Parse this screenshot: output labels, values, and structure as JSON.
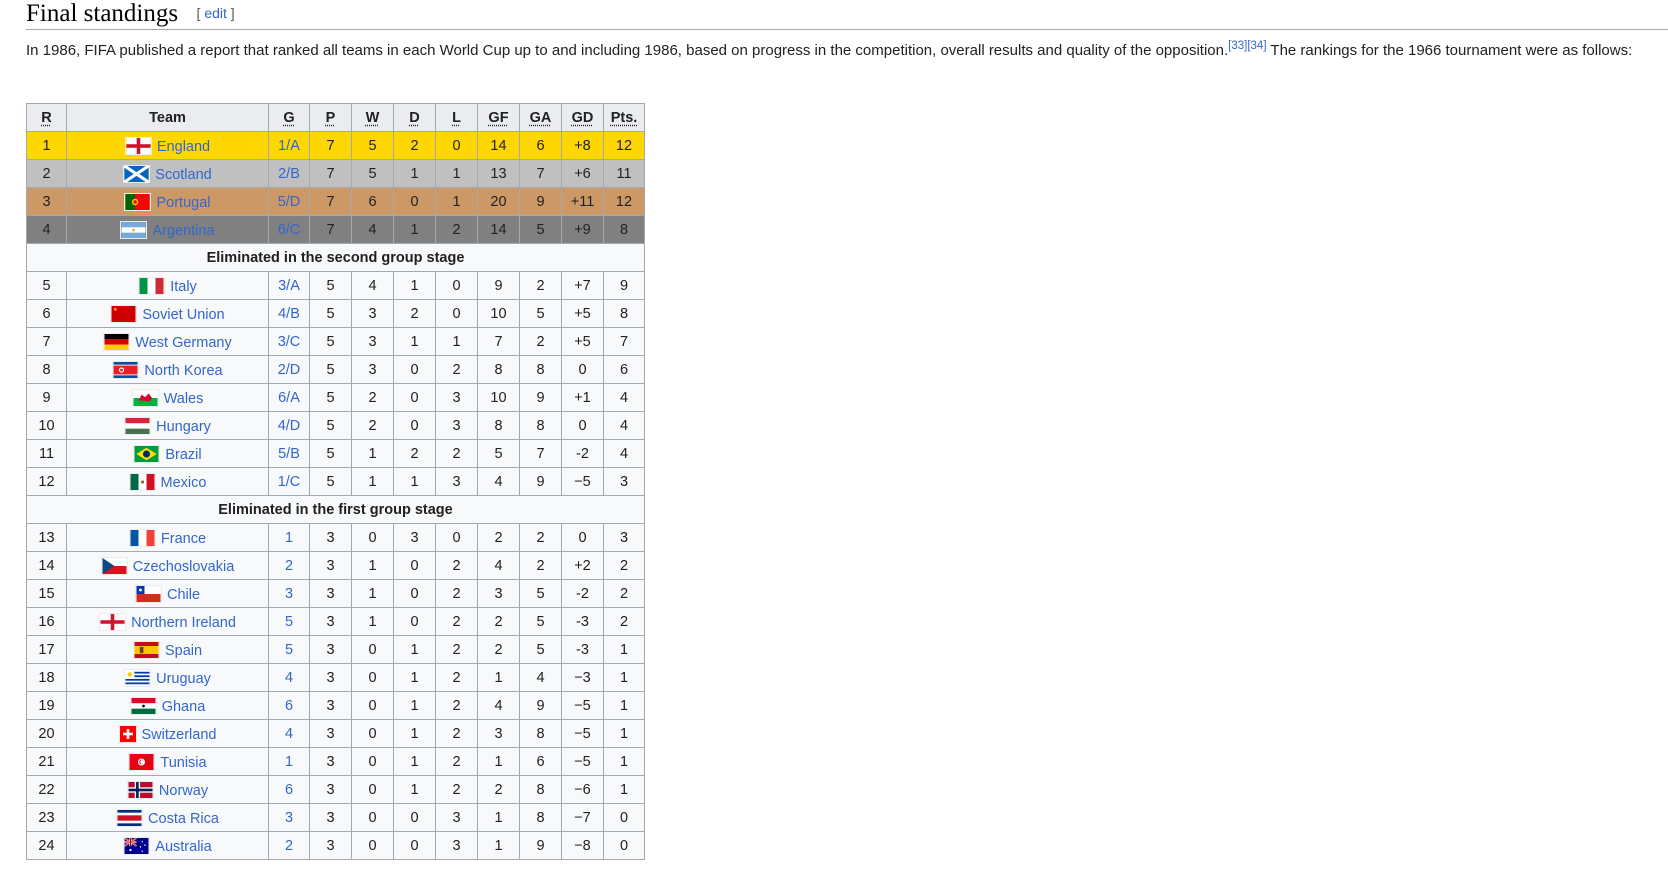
{
  "section": {
    "title": "Final standings",
    "edit_open": "[",
    "edit_label": "edit",
    "edit_close": "]"
  },
  "intro": {
    "text_before": "In 1986, FIFA published a report that ranked all teams in each World Cup up to and including 1986, based on progress in the competition, overall results and quality of the opposition.",
    "refs": [
      "[33]",
      "[34]"
    ],
    "text_after": " The rankings for the 1966 tournament were as follows:"
  },
  "table": {
    "headers": [
      "R",
      "Team",
      "G",
      "P",
      "W",
      "D",
      "L",
      "GF",
      "GA",
      "GD",
      "Pts."
    ],
    "sections": {
      "second_group": "Eliminated in the second group stage",
      "first_group": "Eliminated in the first group stage"
    },
    "rows": [
      {
        "r": "1",
        "team": "England",
        "flag": "england-flag",
        "g": "1/A",
        "p": "7",
        "w": "5",
        "d": "2",
        "l": "0",
        "gf": "14",
        "ga": "6",
        "gd": "+8",
        "pts": "12",
        "medal": "gold"
      },
      {
        "r": "2",
        "team": "Scotland",
        "flag": "scotland-flag",
        "g": "2/B",
        "p": "7",
        "w": "5",
        "d": "1",
        "l": "1",
        "gf": "13",
        "ga": "7",
        "gd": "+6",
        "pts": "11",
        "medal": "silver"
      },
      {
        "r": "3",
        "team": "Portugal",
        "flag": "portugal-flag",
        "g": "5/D",
        "p": "7",
        "w": "6",
        "d": "0",
        "l": "1",
        "gf": "20",
        "ga": "9",
        "gd": "+11",
        "pts": "12",
        "medal": "bronze"
      },
      {
        "r": "4",
        "team": "Argentina",
        "flag": "argentina-flag",
        "g": "6/C",
        "p": "7",
        "w": "4",
        "d": "1",
        "l": "2",
        "gf": "14",
        "ga": "5",
        "gd": "+9",
        "pts": "8",
        "medal": "fourth"
      },
      {
        "r": "5",
        "team": "Italy",
        "flag": "italy-flag",
        "g": "3/A",
        "p": "5",
        "w": "4",
        "d": "1",
        "l": "0",
        "gf": "9",
        "ga": "2",
        "gd": "+7",
        "pts": "9"
      },
      {
        "r": "6",
        "team": "Soviet Union",
        "flag": "soviet-union-flag",
        "g": "4/B",
        "p": "5",
        "w": "3",
        "d": "2",
        "l": "0",
        "gf": "10",
        "ga": "5",
        "gd": "+5",
        "pts": "8"
      },
      {
        "r": "7",
        "team": "West Germany",
        "flag": "west-germany-flag",
        "g": "3/C",
        "p": "5",
        "w": "3",
        "d": "1",
        "l": "1",
        "gf": "7",
        "ga": "2",
        "gd": "+5",
        "pts": "7"
      },
      {
        "r": "8",
        "team": "North Korea",
        "flag": "north-korea-flag",
        "g": "2/D",
        "p": "5",
        "w": "3",
        "d": "0",
        "l": "2",
        "gf": "8",
        "ga": "8",
        "gd": "0",
        "pts": "6"
      },
      {
        "r": "9",
        "team": "Wales",
        "flag": "wales-flag",
        "g": "6/A",
        "p": "5",
        "w": "2",
        "d": "0",
        "l": "3",
        "gf": "10",
        "ga": "9",
        "gd": "+1",
        "pts": "4"
      },
      {
        "r": "10",
        "team": "Hungary",
        "flag": "hungary-flag",
        "g": "4/D",
        "p": "5",
        "w": "2",
        "d": "0",
        "l": "3",
        "gf": "8",
        "ga": "8",
        "gd": "0",
        "pts": "4"
      },
      {
        "r": "11",
        "team": "Brazil",
        "flag": "brazil-flag",
        "g": "5/B",
        "p": "5",
        "w": "1",
        "d": "2",
        "l": "2",
        "gf": "5",
        "ga": "7",
        "gd": "-2",
        "pts": "4"
      },
      {
        "r": "12",
        "team": "Mexico",
        "flag": "mexico-flag",
        "g": "1/C",
        "p": "5",
        "w": "1",
        "d": "1",
        "l": "3",
        "gf": "4",
        "ga": "9",
        "gd": "−5",
        "pts": "3"
      },
      {
        "r": "13",
        "team": "France",
        "flag": "france-flag",
        "g": "1",
        "p": "3",
        "w": "0",
        "d": "3",
        "l": "0",
        "gf": "2",
        "ga": "2",
        "gd": "0",
        "pts": "3"
      },
      {
        "r": "14",
        "team": "Czechoslovakia",
        "flag": "czechoslovakia-flag",
        "g": "2",
        "p": "3",
        "w": "1",
        "d": "0",
        "l": "2",
        "gf": "4",
        "ga": "2",
        "gd": "+2",
        "pts": "2"
      },
      {
        "r": "15",
        "team": "Chile",
        "flag": "chile-flag",
        "g": "3",
        "p": "3",
        "w": "1",
        "d": "0",
        "l": "2",
        "gf": "3",
        "ga": "5",
        "gd": "-2",
        "pts": "2"
      },
      {
        "r": "16",
        "team": "Northern Ireland",
        "flag": "northern-ireland-flag",
        "g": "5",
        "p": "3",
        "w": "1",
        "d": "0",
        "l": "2",
        "gf": "2",
        "ga": "5",
        "gd": "-3",
        "pts": "2"
      },
      {
        "r": "17",
        "team": "Spain",
        "flag": "spain-flag",
        "g": "5",
        "p": "3",
        "w": "0",
        "d": "1",
        "l": "2",
        "gf": "2",
        "ga": "5",
        "gd": "-3",
        "pts": "1"
      },
      {
        "r": "18",
        "team": "Uruguay",
        "flag": "uruguay-flag",
        "g": "4",
        "p": "3",
        "w": "0",
        "d": "1",
        "l": "2",
        "gf": "1",
        "ga": "4",
        "gd": "−3",
        "pts": "1"
      },
      {
        "r": "19",
        "team": "Ghana",
        "flag": "ghana-flag",
        "g": "6",
        "p": "3",
        "w": "0",
        "d": "1",
        "l": "2",
        "gf": "4",
        "ga": "9",
        "gd": "−5",
        "pts": "1"
      },
      {
        "r": "20",
        "team": "Switzerland",
        "flag": "switzerland-flag",
        "g": "4",
        "p": "3",
        "w": "0",
        "d": "1",
        "l": "2",
        "gf": "3",
        "ga": "8",
        "gd": "−5",
        "pts": "1"
      },
      {
        "r": "21",
        "team": "Tunisia",
        "flag": "tunisia-flag",
        "g": "1",
        "p": "3",
        "w": "0",
        "d": "1",
        "l": "2",
        "gf": "1",
        "ga": "6",
        "gd": "−5",
        "pts": "1"
      },
      {
        "r": "22",
        "team": "Norway",
        "flag": "norway-flag",
        "g": "6",
        "p": "3",
        "w": "0",
        "d": "1",
        "l": "2",
        "gf": "2",
        "ga": "8",
        "gd": "−6",
        "pts": "1"
      },
      {
        "r": "23",
        "team": "Costa Rica",
        "flag": "costa-rica-flag",
        "g": "3",
        "p": "3",
        "w": "0",
        "d": "0",
        "l": "3",
        "gf": "1",
        "ga": "8",
        "gd": "−7",
        "pts": "0"
      },
      {
        "r": "24",
        "team": "Australia",
        "flag": "australia-flag",
        "g": "2",
        "p": "3",
        "w": "0",
        "d": "0",
        "l": "3",
        "gf": "1",
        "ga": "9",
        "gd": "−8",
        "pts": "0"
      }
    ]
  },
  "colors": {
    "link": "#3366cc",
    "gold": "#ffd700",
    "silver": "#c0c0c0",
    "bronze": "#cc9966",
    "fourth": "#808080",
    "header_bg": "#eaecf0",
    "cell_bg": "#f8f9fa",
    "border": "#a2a9b1"
  }
}
